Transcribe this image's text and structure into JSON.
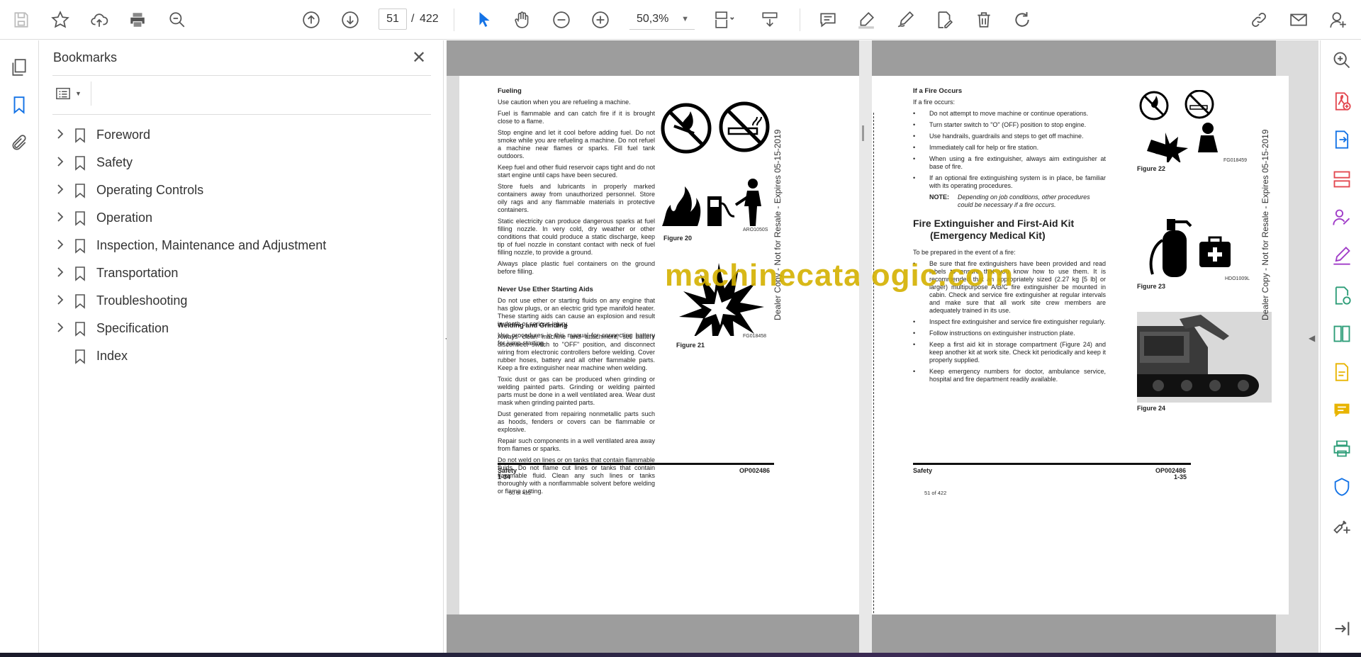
{
  "toolbar": {
    "page_current": "51",
    "page_separator": "/",
    "page_total": "422",
    "zoom": "50,3%"
  },
  "bookmarks_panel": {
    "title": "Bookmarks",
    "items": [
      {
        "label": "Foreword",
        "expandable": true
      },
      {
        "label": "Safety",
        "expandable": true
      },
      {
        "label": "Operating Controls",
        "expandable": true
      },
      {
        "label": "Operation",
        "expandable": true
      },
      {
        "label": "Inspection, Maintenance and Adjustment",
        "expandable": true
      },
      {
        "label": "Transportation",
        "expandable": true
      },
      {
        "label": "Troubleshooting",
        "expandable": true
      },
      {
        "label": "Specification",
        "expandable": true
      },
      {
        "label": "Index",
        "expandable": false
      }
    ]
  },
  "doc": {
    "left": {
      "fueling_title": "Fueling",
      "fueling_paras": [
        "Use caution when you are refueling a machine.",
        "Fuel is flammable and can catch fire if it is brought close to a flame.",
        "Stop engine and let it cool before adding fuel. Do not smoke while you are refueling a machine. Do not refuel a machine near flames or sparks. Fill fuel tank outdoors.",
        "Keep fuel and other fluid reservoir caps tight and do not start engine until caps have been secured.",
        "Store fuels and lubricants in properly marked containers away from unauthorized personnel. Store oily rags and any flammable materials in protective containers.",
        "Static electricity can produce dangerous sparks at fuel filling nozzle. In very cold, dry weather or other conditions that could produce a static discharge, keep tip of fuel nozzle in constant contact with neck of fuel filling nozzle, to provide a ground.",
        "Always place plastic fuel containers on the ground before filling."
      ],
      "ether_title": "Never Use Ether Starting Aids",
      "ether_paras": [
        "Do not use ether or starting fluids on any engine that has glow plugs, or an electric grid type manifold heater. These starting aids can cause an explosion and result in death or serious injury.",
        "Use procedures in this manual for connecting battery for jump-starting."
      ],
      "welding_title": "Welding and Grinding",
      "welding_paras": [
        "Always clean machine and attachment, set battery disconnect switch to \"OFF\" position, and disconnect wiring from electronic controllers before welding. Cover rubber hoses, battery and all other flammable parts. Keep a fire extinguisher near machine when welding.",
        "Toxic dust or gas can be produced when grinding or welding painted parts. Grinding or welding painted parts must be done in a well ventilated area. Wear dust mask when grinding painted parts.",
        "Dust generated from repairing nonmetallic parts such as hoods, fenders or covers can be flammable or explosive.",
        "Repair such components in a well ventilated area away from flames or sparks.",
        "Do not weld on lines or on tanks that contain flammable fluids. Do not flame cut lines or tanks that contain flammable fluid. Clean any such lines or tanks thoroughly with a nonflammable solvent before welding or flame cutting."
      ],
      "fig20_label": "Figure 20",
      "fig20_id": "ARO1050S",
      "fig21_label": "Figure 21",
      "fig21_id": "FG018458",
      "footer_left": "Safety",
      "footer_left2": "1-34",
      "footer_right": "OP002486",
      "page_of": "50 of 422"
    },
    "right": {
      "fire_title": "If a Fire Occurs",
      "fire_intro": "If a fire occurs:",
      "fire_items": [
        "Do not attempt to move machine or continue operations.",
        "Turn starter switch to \"O\" (OFF) position to stop engine.",
        "Use handrails, guardrails and steps to get off machine.",
        "Immediately call for help or fire station.",
        "When using a fire extinguisher, always aim extinguisher at base of fire.",
        "If an optional fire extinguishing system is in place, be familiar with its operating procedures."
      ],
      "note_label": "NOTE:",
      "note_text": "Depending on job conditions, other procedures could be necessary if a fire occurs.",
      "kit_title_1": "Fire Extinguisher and First-Aid Kit",
      "kit_title_2": "(Emergency Medical Kit)",
      "kit_intro": "To be prepared in the event of a fire:",
      "kit_items": [
        "Be sure that fire extinguishers have been provided and read labels to ensure that you know how to use them. It is recommended that an appropriately sized (2.27 kg [5 lb] or larger) multipurpose A/B/C fire extinguisher be mounted in cabin. Check and service fire extinguisher at regular intervals and make sure that all work site crew members are adequately trained in its use.",
        "Inspect fire extinguisher and service fire extinguisher regularly.",
        "Follow instructions on extinguisher instruction plate.",
        "Keep a first aid kit in storage compartment (Figure 24) and keep another kit at work site. Check kit periodically and keep it properly supplied.",
        "Keep emergency numbers for doctor, ambulance service, hospital and fire department readily available."
      ],
      "fig22_label": "Figure 22",
      "fig22_id": "FG018459",
      "fig23_label": "Figure 23",
      "fig23_id": "HDO1009L",
      "fig24_label": "Figure 24",
      "footer_left": "Safety",
      "footer_right": "OP002486",
      "footer_right2": "1-35",
      "page_of": "51 of 422"
    },
    "vertical_stamp": "Dealer Copy - Not for Resale - Expires 05-15-2019",
    "watermark": "machinecatalogic.com"
  },
  "colors": {
    "accent": "#1473e6",
    "watermark": "#d4b100",
    "tool_red": "#e34850",
    "tool_purple": "#a03cc8",
    "tool_green": "#2d9d78",
    "tool_yellow": "#e8b400"
  }
}
